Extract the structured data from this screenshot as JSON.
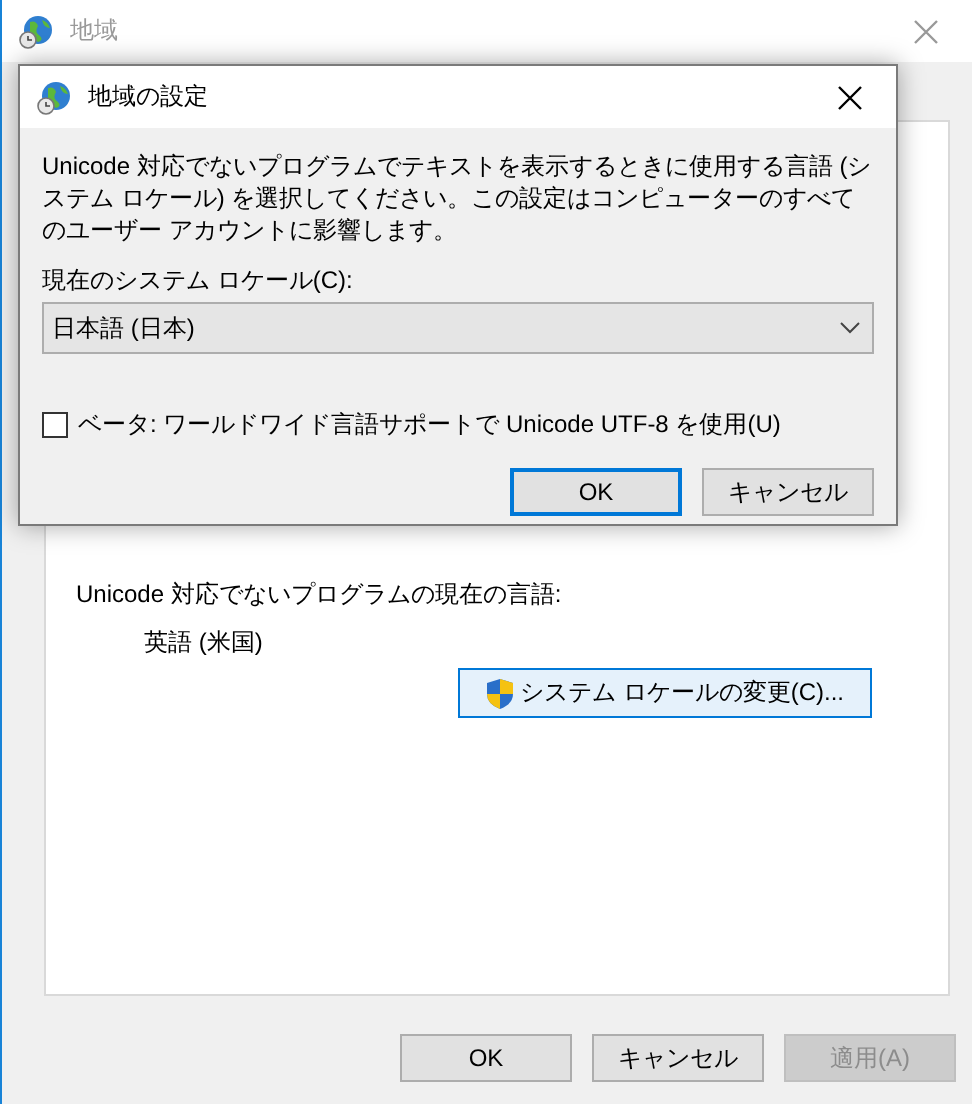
{
  "window": {
    "title": "地域"
  },
  "panel": {
    "label": "Unicode 対応でないプログラムの現在の言語:",
    "current_language": "英語 (米国)",
    "change_button": "システム ロケールの変更(C)..."
  },
  "buttons": [
    {
      "label": "OK",
      "disabled": false
    },
    {
      "label": "キャンセル",
      "disabled": false
    },
    {
      "label": "適用(A)",
      "disabled": true
    }
  ],
  "dialog": {
    "title": "地域の設定",
    "description": "Unicode 対応でないプログラムでテキストを表示するときに使用する言語 (システム ロケール) を選択してください。この設定はコンピューターのすべてのユーザー アカウントに影響します。",
    "locale_label": "現在のシステム ロケール(C):",
    "locale_value": "日本語 (日本)",
    "beta_checkbox": {
      "label": "ベータ: ワールドワイド言語サポートで Unicode UTF-8 を使用(U)",
      "checked": false
    },
    "buttons": [
      {
        "label": "OK",
        "default": true
      },
      {
        "label": "キャンセル",
        "default": false
      }
    ]
  }
}
